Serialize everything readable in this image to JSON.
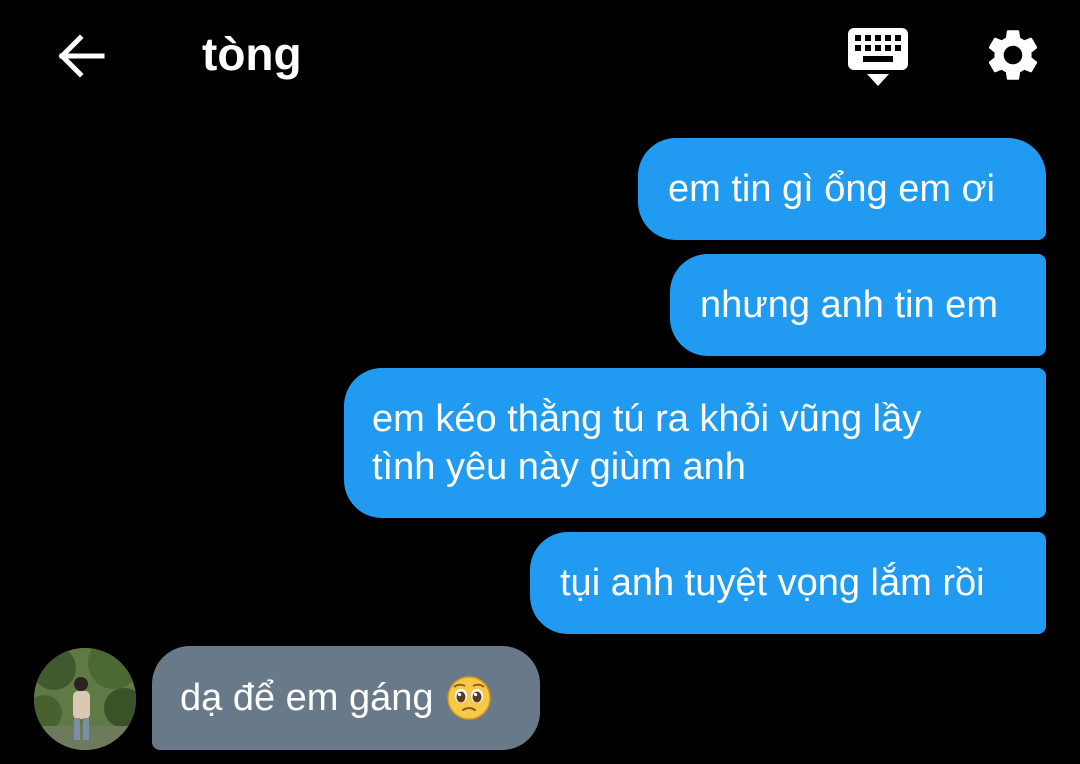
{
  "header": {
    "back_icon": "arrow-left-icon",
    "title": "tòng",
    "keyboard_icon": "keyboard-icon",
    "settings_icon": "gear-icon"
  },
  "messages": [
    {
      "direction": "outgoing",
      "text": "em tin gì ổng em ơi"
    },
    {
      "direction": "outgoing",
      "text": "nhưng anh tin em"
    },
    {
      "direction": "outgoing",
      "lines": [
        "em kéo thằng tú ra khỏi vũng lầy",
        "tình yêu này giùm anh"
      ]
    },
    {
      "direction": "outgoing",
      "text": "tụi anh tuyệt vọng lắm rồi"
    },
    {
      "direction": "incoming",
      "text": "dạ để em gáng",
      "emoji": "pleading-face-icon"
    }
  ],
  "colors": {
    "background": "#000000",
    "outgoing_bubble": "#209bf1",
    "incoming_bubble": "#687a89",
    "text": "#ffffff"
  }
}
